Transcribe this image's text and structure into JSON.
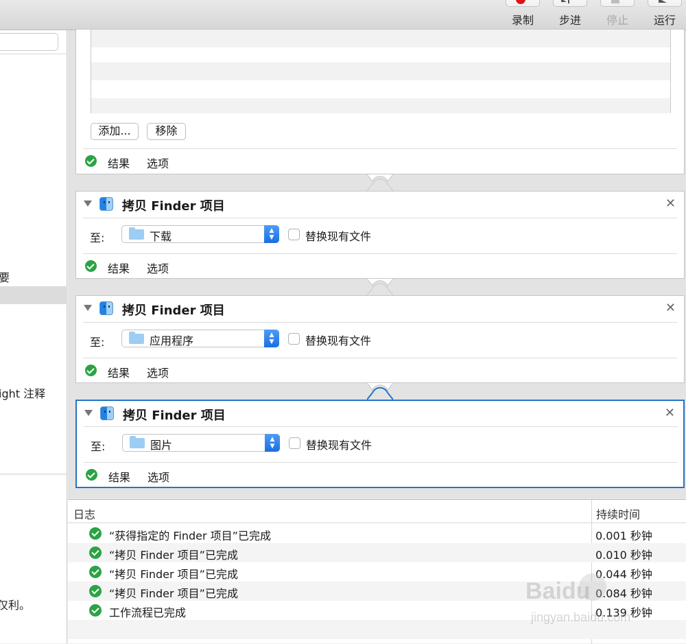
{
  "toolbar": {
    "record": "录制",
    "step": "步进",
    "stop": "停止",
    "run": "运行"
  },
  "sidebar": {
    "fragments": [
      "要",
      "ight 注释",
      "仅利。"
    ]
  },
  "top_action": {
    "add_button": "添加...",
    "remove_button": "移除",
    "results_label": "结果",
    "options_label": "选项"
  },
  "actions": [
    {
      "title": "拷贝 Finder 项目",
      "to_label": "至:",
      "destination": "下载",
      "replace_label": "替换现有文件",
      "results_label": "结果",
      "options_label": "选项"
    },
    {
      "title": "拷贝 Finder 项目",
      "to_label": "至:",
      "destination": "应用程序",
      "replace_label": "替换现有文件",
      "results_label": "结果",
      "options_label": "选项"
    },
    {
      "title": "拷贝 Finder 项目",
      "to_label": "至:",
      "destination": "图片",
      "replace_label": "替换现有文件",
      "results_label": "结果",
      "options_label": "选项"
    }
  ],
  "log": {
    "col_log": "日志",
    "col_duration": "持续时间",
    "rows": [
      {
        "message": "“获得指定的 Finder 项目”已完成",
        "duration": "0.001 秒钟"
      },
      {
        "message": "“拷贝 Finder 项目”已完成",
        "duration": "0.010 秒钟"
      },
      {
        "message": "“拷贝 Finder 项目”已完成",
        "duration": "0.044 秒钟"
      },
      {
        "message": "“拷贝 Finder 项目”已完成",
        "duration": "0.084 秒钟"
      },
      {
        "message": "工作流程已完成",
        "duration": "0.139 秒钟"
      }
    ]
  },
  "watermark": {
    "brand": "Baidu",
    "site": "jingyan.baidu.com"
  },
  "colors": {
    "selection_border": "#2374c6",
    "success_green": "#2ba345",
    "record_red": "#e0111b",
    "popup_blue": "#1a6fe0"
  }
}
